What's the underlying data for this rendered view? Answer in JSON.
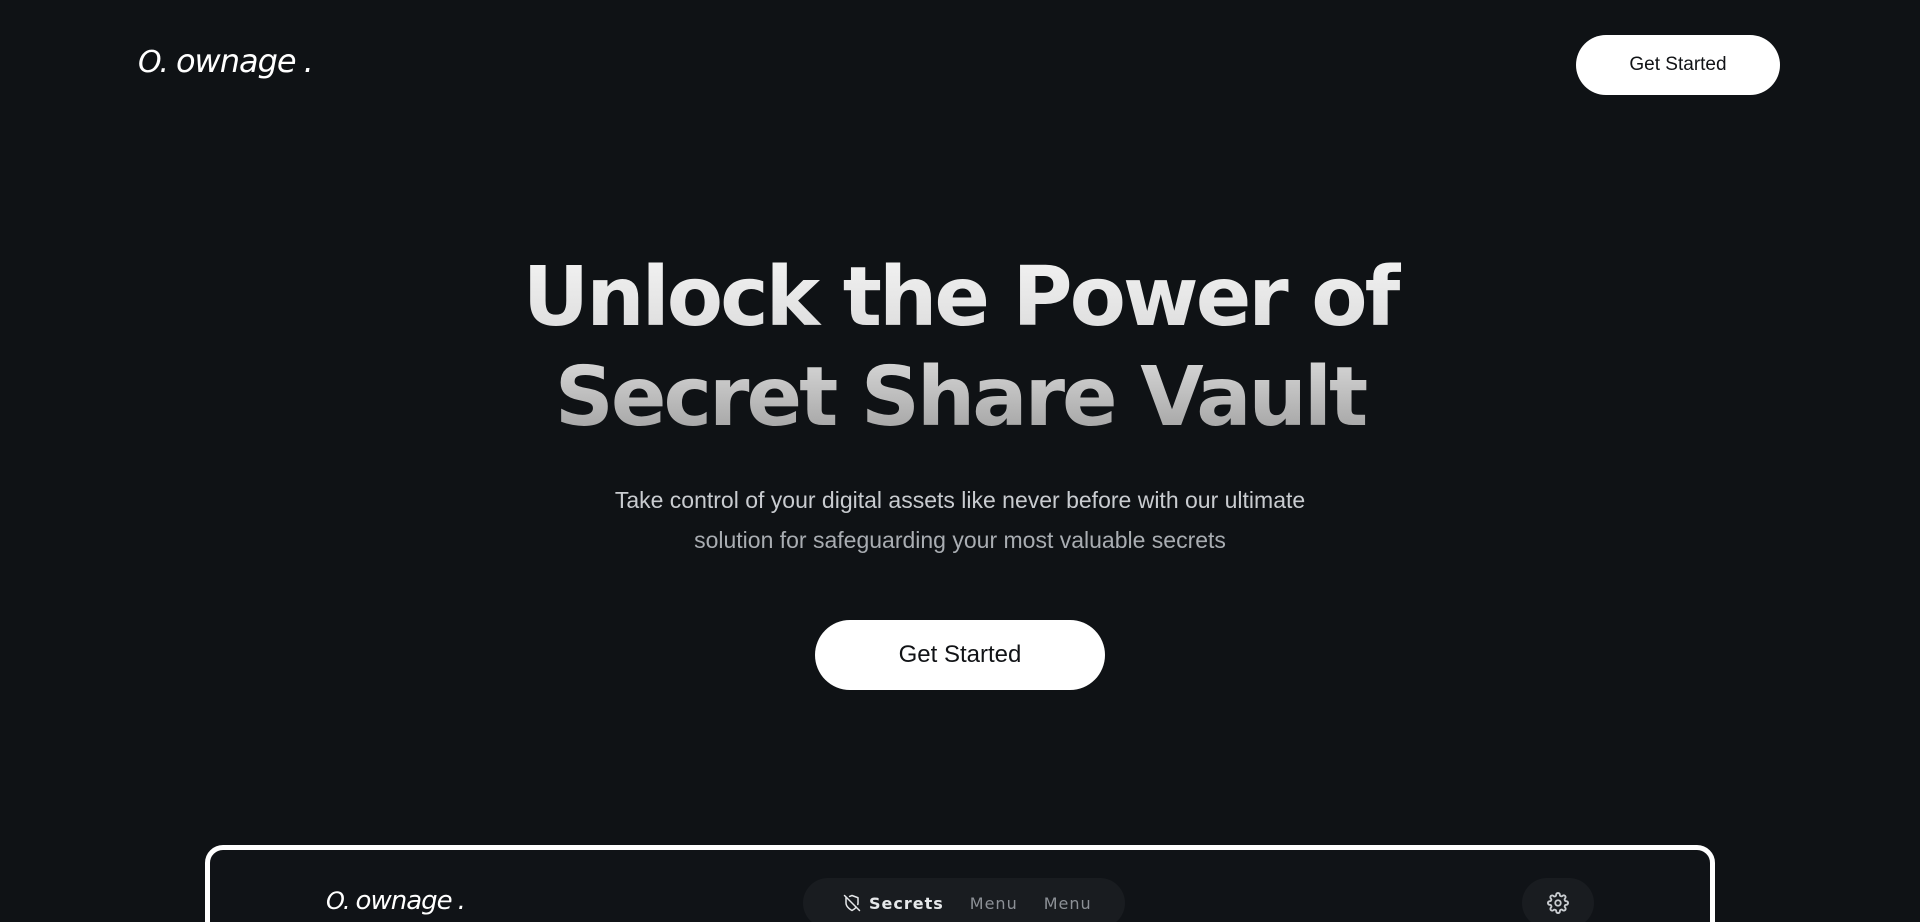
{
  "header": {
    "logo_mark": "O.",
    "logo_word": "ownage",
    "logo_dot": ".",
    "cta_label": "Get Started"
  },
  "hero": {
    "title_line1": "Unlock the Power of",
    "title_line2": "Secret Share Vault",
    "subtitle_line1": "Take control of your digital assets like never before with our ultimate",
    "subtitle_line2": "solution for safeguarding your most valuable secrets",
    "cta_label": "Get Started"
  },
  "preview": {
    "logo_mark": "O.",
    "logo_word": "ownage",
    "logo_dot": ".",
    "nav": [
      {
        "label": "Secrets",
        "icon": "shield-off-icon",
        "active": true
      },
      {
        "label": "Menu",
        "active": false
      },
      {
        "label": "Menu",
        "active": false
      }
    ],
    "settings_icon": "gear-icon"
  },
  "colors": {
    "background": "#0f1215",
    "button_bg": "#ffffff",
    "button_text": "#111316",
    "nav_bg": "#191c20"
  }
}
